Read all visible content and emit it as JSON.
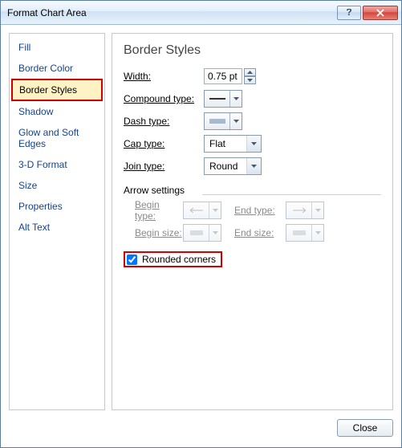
{
  "window": {
    "title": "Format Chart Area"
  },
  "sidebar": {
    "items": [
      {
        "label": "Fill"
      },
      {
        "label": "Border Color"
      },
      {
        "label": "Border Styles"
      },
      {
        "label": "Shadow"
      },
      {
        "label": "Glow and Soft Edges"
      },
      {
        "label": "3-D Format"
      },
      {
        "label": "Size"
      },
      {
        "label": "Properties"
      },
      {
        "label": "Alt Text"
      }
    ],
    "selected_index": 2
  },
  "panel": {
    "heading": "Border Styles",
    "width": {
      "label": "Width:",
      "value": "0.75 pt"
    },
    "compound": {
      "label": "Compound type:"
    },
    "dash": {
      "label": "Dash type:"
    },
    "cap": {
      "label": "Cap type:",
      "value": "Flat"
    },
    "join": {
      "label": "Join type:",
      "value": "Round"
    },
    "arrow_section": "Arrow settings",
    "begin_type": "Begin type:",
    "end_type": "End type:",
    "begin_size": "Begin size:",
    "end_size": "End size:",
    "rounded": {
      "label": "Rounded corners",
      "checked": true
    }
  },
  "footer": {
    "close": "Close"
  }
}
